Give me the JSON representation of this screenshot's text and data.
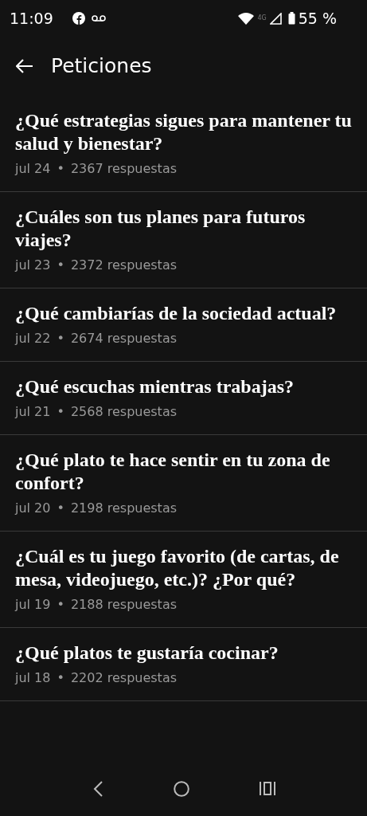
{
  "status_bar": {
    "time": "11:09",
    "network_type": "4G",
    "battery": "55 %"
  },
  "app_bar": {
    "title": "Peticiones"
  },
  "prompts": [
    {
      "title": "¿Qué estrategias sigues para mantener tu salud y bienestar?",
      "date": "jul 24",
      "separator": "•",
      "answers": "2367 respuestas"
    },
    {
      "title": "¿Cuáles son tus planes para futuros viajes?",
      "date": "jul 23",
      "separator": "•",
      "answers": "2372 respuestas"
    },
    {
      "title": "¿Qué cambiarías de la sociedad actual?",
      "date": "jul 22",
      "separator": "•",
      "answers": "2674 respuestas"
    },
    {
      "title": "¿Qué escuchas mientras trabajas?",
      "date": "jul 21",
      "separator": "•",
      "answers": "2568 respuestas"
    },
    {
      "title": "¿Qué plato te hace sentir en tu zona de confort?",
      "date": "jul 20",
      "separator": "•",
      "answers": "2198 respuestas"
    },
    {
      "title": "¿Cuál es tu juego favorito (de cartas, de mesa, videojuego, etc.)? ¿Por qué?",
      "date": "jul 19",
      "separator": "•",
      "answers": "2188 respuestas"
    },
    {
      "title": "¿Qué platos te gustaría cocinar?",
      "date": "jul 18",
      "separator": "•",
      "answers": "2202 respuestas"
    }
  ]
}
